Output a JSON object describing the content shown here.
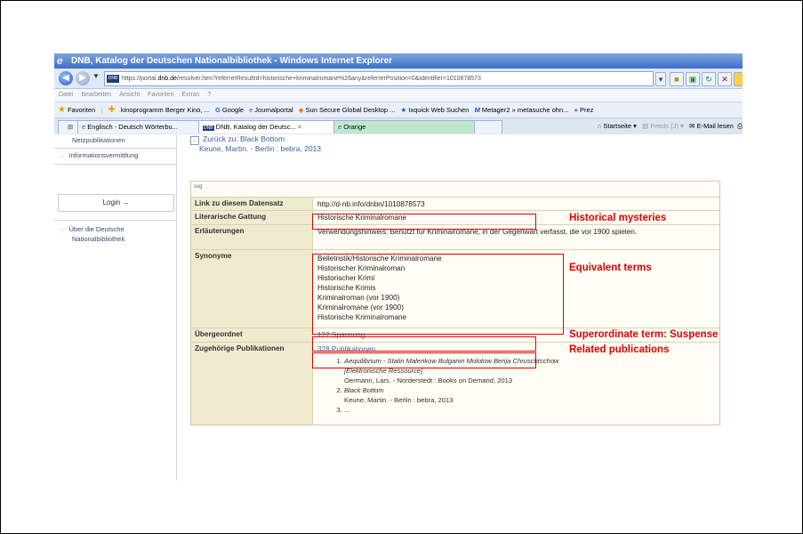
{
  "window": {
    "title": "DNB, Katalog der Deutschen Nationalbibliothek - Windows Internet Explorer"
  },
  "address": {
    "url_prefix": "https://portal.",
    "url_domain": "dnb.de",
    "url_rest": "/resolver.htm?referrerResultId=historische+kriminalromane%26any&referrerPosition=0&identifier=1010878573"
  },
  "menu": [
    "Datei",
    "Bearbeiten",
    "Ansicht",
    "Favoriten",
    "Extras",
    "?"
  ],
  "favorites": {
    "label": "Favoriten",
    "items": [
      "kinoprogramm Berger Kino, ...",
      "Google",
      "Journalportal",
      "Sun Secure Global Desktop ...",
      "Ixquick Web Suchen",
      "Metager2 » metasuche ohn...",
      "Prez"
    ]
  },
  "tabs": {
    "items": [
      "Englisch - Deutsch Wörterbu...",
      "DNB, Katalog der Deutsc...",
      "Orange"
    ],
    "close": "×",
    "right": {
      "home": "Startseite",
      "feeds": "Feeds (J)",
      "mail": "E-Mail lesen"
    }
  },
  "sidebar": {
    "top_item": "Netzpublikationen",
    "info_item": "Informationsvermittlung",
    "login": "Login →",
    "about": [
      "Über die Deutsche",
      "Nationalbibliothek"
    ]
  },
  "content": {
    "back_label": "Zurück zu: Black Bottom",
    "back_sub": "Keune, Martin. - Berlin : bebra, 2013",
    "vis_icon": "svg"
  },
  "record": {
    "link_label": "Link zu diesem Datensatz",
    "link_value": "http://d-nb.info/dnbn/1010878573",
    "genre_label": "Literarische Gattung",
    "genre_value": "Historische Kriminalromane",
    "notes_label": "Erläuterungen",
    "notes_value": "Verwendungshinweis: Benutzt für Kriminalromane, in der Gegenwart verfasst, die vor 1900 spielen.",
    "synonyms_label": "Synonyme",
    "synonyms": [
      "Belletristik/Historische Kriminalromane",
      "Historischer Kriminalroman",
      "Historischer Krimi",
      "Historische Krimis",
      "Kriminalroman (vor 1900)",
      "Kriminalromane (vor 1900)",
      "Historische Kriminalromane"
    ],
    "broader_label": "Übergeordnet",
    "broader_value": "122 Spannung",
    "pubs_label": "Zugehörige Publikationen",
    "pubs_value": "328 Publikationen",
    "publications": [
      {
        "title": "Aequilibrium - Stalin Malenkow Bulganin Molotow Berija Chruschtschow",
        "title2": "[Elektronische Ressource]",
        "info": "Oermann, Lars. - Norderstedt : Books on Demand, 2013"
      },
      {
        "title": "Black Bottom",
        "title2": "",
        "info": "Keune, Martin. - Berlin : bebra, 2013"
      },
      {
        "title": "...",
        "title2": "",
        "info": ""
      }
    ]
  },
  "annotations": {
    "genre": "Historical mysteries",
    "synonyms": "Equivalent terms",
    "broader": "Superordinate term: Suspense",
    "pubs": "Related publications"
  },
  "colors": {
    "annotation_red": "#e00000",
    "link_blue": "#3b5fa0",
    "title_blue": "#3d6fc8"
  }
}
